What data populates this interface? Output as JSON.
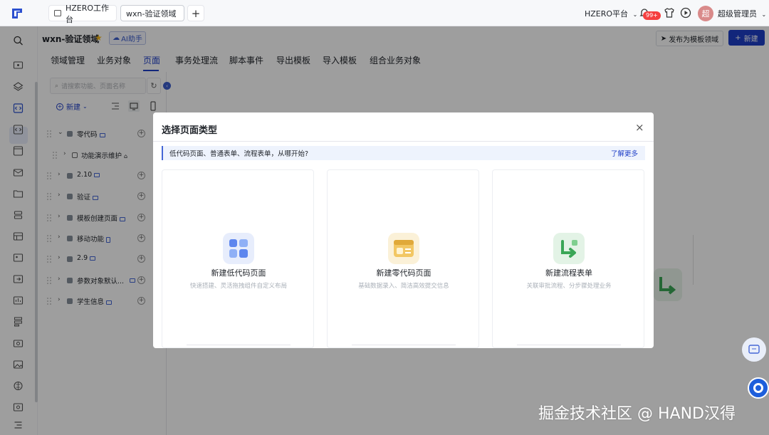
{
  "topbar": {
    "tabs": [
      {
        "label": "HZERO工作台"
      },
      {
        "label": "wxn-验证领域"
      }
    ],
    "add_tab": "+",
    "platform": "HZERO平台",
    "notification_badge": "99+",
    "avatar_initial": "超",
    "user_name": "超级管理员"
  },
  "app": {
    "name": "wxn-验证领域",
    "ai_label": "AI助手",
    "publish_label": "发布为模板领域",
    "new_label": "新建"
  },
  "nav_tabs": [
    {
      "label": "领域管理"
    },
    {
      "label": "业务对象"
    },
    {
      "label": "页面"
    },
    {
      "label": "事务处理流"
    },
    {
      "label": "脚本事件"
    },
    {
      "label": "导出模板"
    },
    {
      "label": "导入模板"
    },
    {
      "label": "组合业务对象"
    }
  ],
  "tree": {
    "search_placeholder": "请搜索功能、页面名称",
    "new_label": "新建",
    "items": [
      {
        "label": "零代码",
        "expanded": true
      },
      {
        "label": "功能演示维护"
      },
      {
        "label": "2.10"
      },
      {
        "label": "验证"
      },
      {
        "label": "模板创建页面"
      },
      {
        "label": "移动功能"
      },
      {
        "label": "2.9"
      },
      {
        "label": "参数对象默认..."
      },
      {
        "label": "学生信息"
      }
    ]
  },
  "modal": {
    "title": "选择页面类型",
    "tip": "低代码页面、普通表单、流程表单，从哪开始?",
    "learn_more": "了解更多",
    "cards": [
      {
        "title": "新建低代码页面",
        "desc": "快速搭建、灵活拖拽组件自定义布局",
        "icon": "grid-blocks-icon"
      },
      {
        "title": "新建零代码页面",
        "desc": "基础数据录入、简洁高效提交信息",
        "icon": "form-card-icon"
      },
      {
        "title": "新建流程表单",
        "desc": "关联审批流程、分步骤处理业务",
        "icon": "flow-arrow-icon"
      }
    ]
  },
  "watermark": "掘金技术社区 @ HAND汉得",
  "colors": {
    "brand": "#1e3ec7",
    "badge": "#f53f3f",
    "tip_bg": "#eef3fd"
  }
}
